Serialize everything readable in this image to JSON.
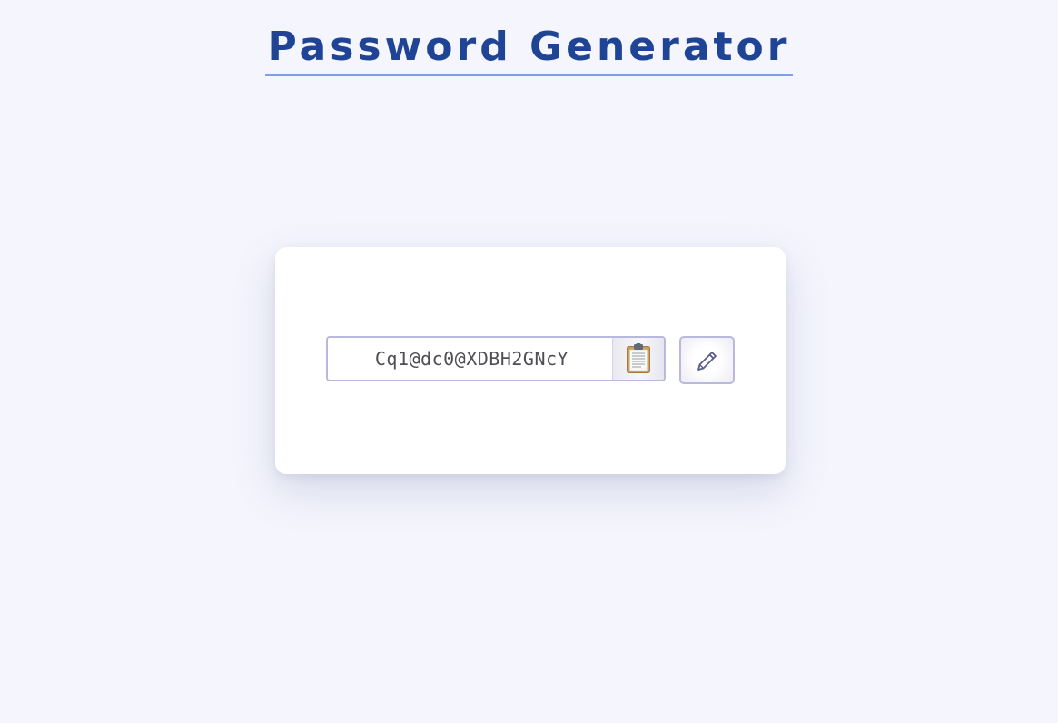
{
  "header": {
    "title": "Password Generator"
  },
  "generator": {
    "password": "Cq1@dc0@XDBH2GNcY",
    "copy_icon": "clipboard-icon",
    "edit_icon": "pencil-icon"
  },
  "colors": {
    "background": "#f4f5fd",
    "title": "#1f4496",
    "title_underline": "#7e9fe8",
    "field_border": "#b9b9e0"
  }
}
